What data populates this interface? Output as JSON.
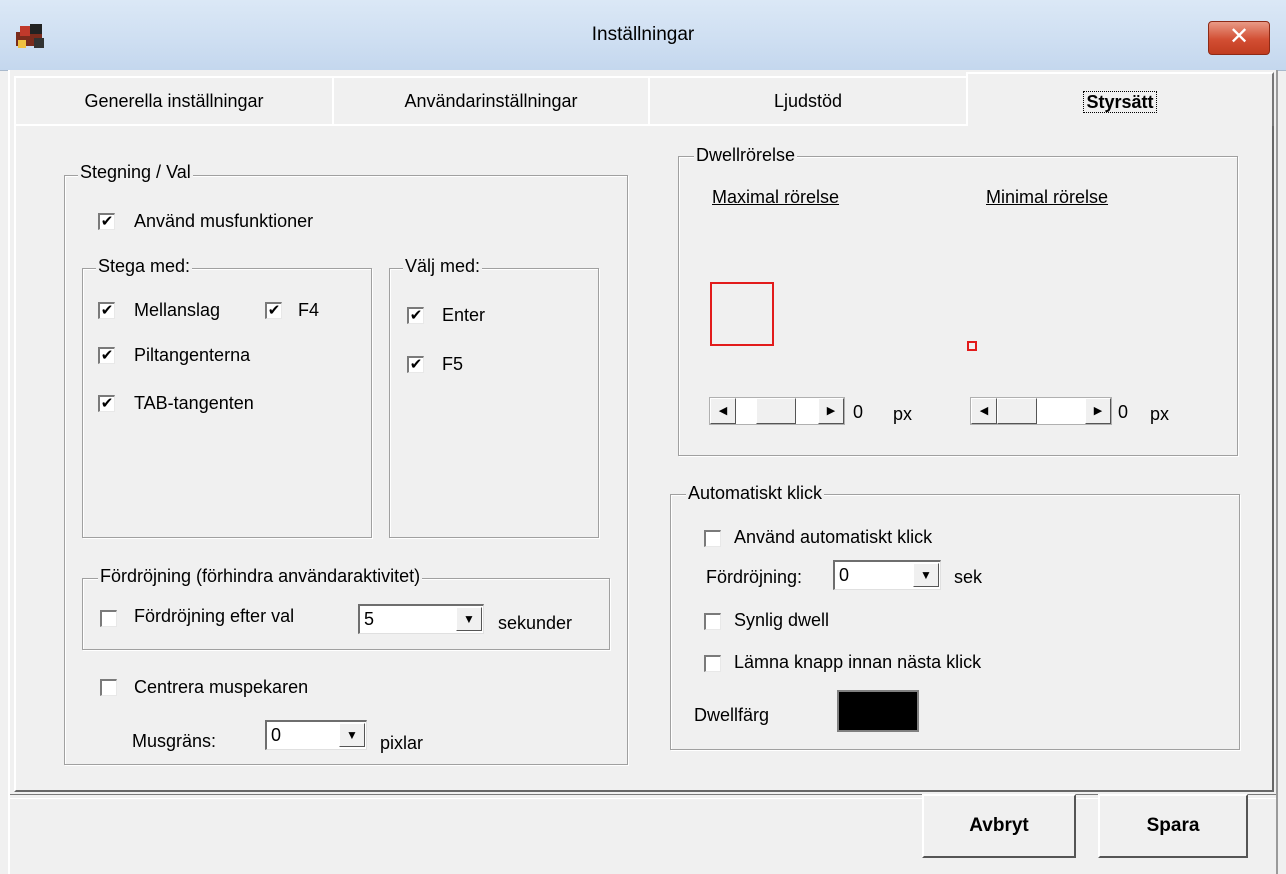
{
  "window": {
    "title": "Inställningar",
    "close_glyph": "✕"
  },
  "tabs": [
    {
      "label": "Generella inställningar"
    },
    {
      "label": "Användarinställningar"
    },
    {
      "label": "Ljudstöd"
    },
    {
      "label": "Styrsätt",
      "active": true
    }
  ],
  "stegning": {
    "legend": "Stegning / Val",
    "use_mouse": {
      "label": "Använd musfunktioner",
      "checked": true
    },
    "stega_med": {
      "legend": "Stega med:",
      "mellanslag": {
        "label": "Mellanslag",
        "checked": true
      },
      "f4": {
        "label": "F4",
        "checked": true
      },
      "piltangenterna": {
        "label": "Piltangenterna",
        "checked": true
      },
      "tab": {
        "label": "TAB-tangenten",
        "checked": true
      }
    },
    "valj_med": {
      "legend": "Välj med:",
      "enter": {
        "label": "Enter",
        "checked": true
      },
      "f5": {
        "label": "F5",
        "checked": true
      }
    },
    "fordrojning": {
      "legend": "Fördröjning (förhindra användaraktivitet)",
      "after_select": {
        "label": "Fördröjning efter val",
        "checked": false
      },
      "value": "5",
      "unit": "sekunder"
    },
    "centrera": {
      "label": "Centrera muspekaren",
      "checked": false
    },
    "musgrans": {
      "label": "Musgräns:",
      "value": "0",
      "unit": "pixlar"
    }
  },
  "dwell": {
    "legend": "Dwellrörelse",
    "max_label": "Maximal rörelse",
    "min_label": "Minimal rörelse",
    "max_value": "0",
    "min_value": "0",
    "unit": "px",
    "box_color": "#e21b1b"
  },
  "auto_click": {
    "legend": "Automatiskt klick",
    "use": {
      "label": "Använd automatiskt klick",
      "checked": false
    },
    "delay_label": "Fördröjning:",
    "delay_value": "0",
    "delay_unit": "sek",
    "visible_dwell": {
      "label": "Synlig dwell",
      "checked": false
    },
    "leave_button": {
      "label": "Lämna knapp innan nästa klick",
      "checked": false
    },
    "color_label": "Dwellfärg",
    "color": "#000000"
  },
  "footer": {
    "cancel": "Avbryt",
    "save": "Spara"
  },
  "icons": {
    "check": "✔",
    "dropdown": "▼",
    "left": "◀",
    "right": "▶"
  }
}
